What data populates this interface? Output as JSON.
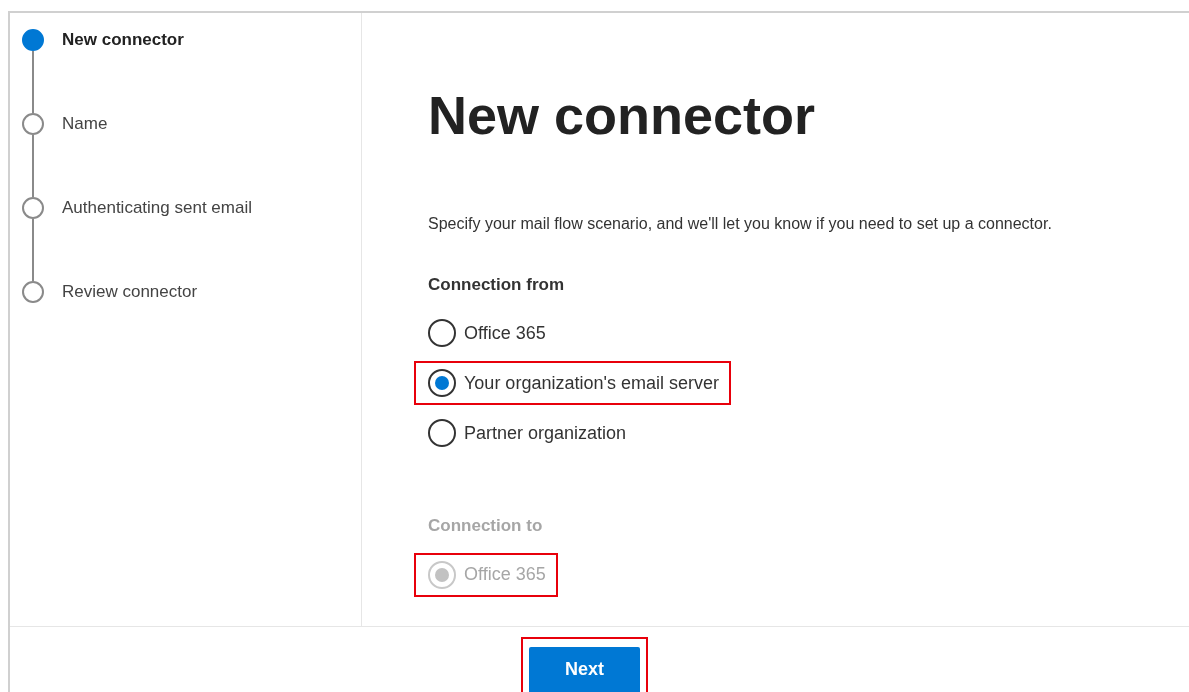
{
  "steps": [
    {
      "label": "New connector",
      "selected": true
    },
    {
      "label": "Name",
      "selected": false
    },
    {
      "label": "Authenticating sent email",
      "selected": false
    },
    {
      "label": "Review connector",
      "selected": false
    }
  ],
  "title": "New connector",
  "description": "Specify your mail flow scenario, and we'll let you know if you need to set up a connector.",
  "groups": [
    {
      "heading": "Connection from",
      "disabled": false,
      "options": [
        {
          "label": "Office 365",
          "selected": false,
          "highlighted": false
        },
        {
          "label": "Your organization's email server",
          "selected": true,
          "highlighted": true
        },
        {
          "label": "Partner organization",
          "selected": false,
          "highlighted": false
        }
      ]
    },
    {
      "heading": "Connection to",
      "disabled": true,
      "options": [
        {
          "label": "Office 365",
          "selected": true,
          "highlighted": true
        }
      ]
    }
  ],
  "next_button": {
    "label": "Next",
    "highlighted": true
  }
}
